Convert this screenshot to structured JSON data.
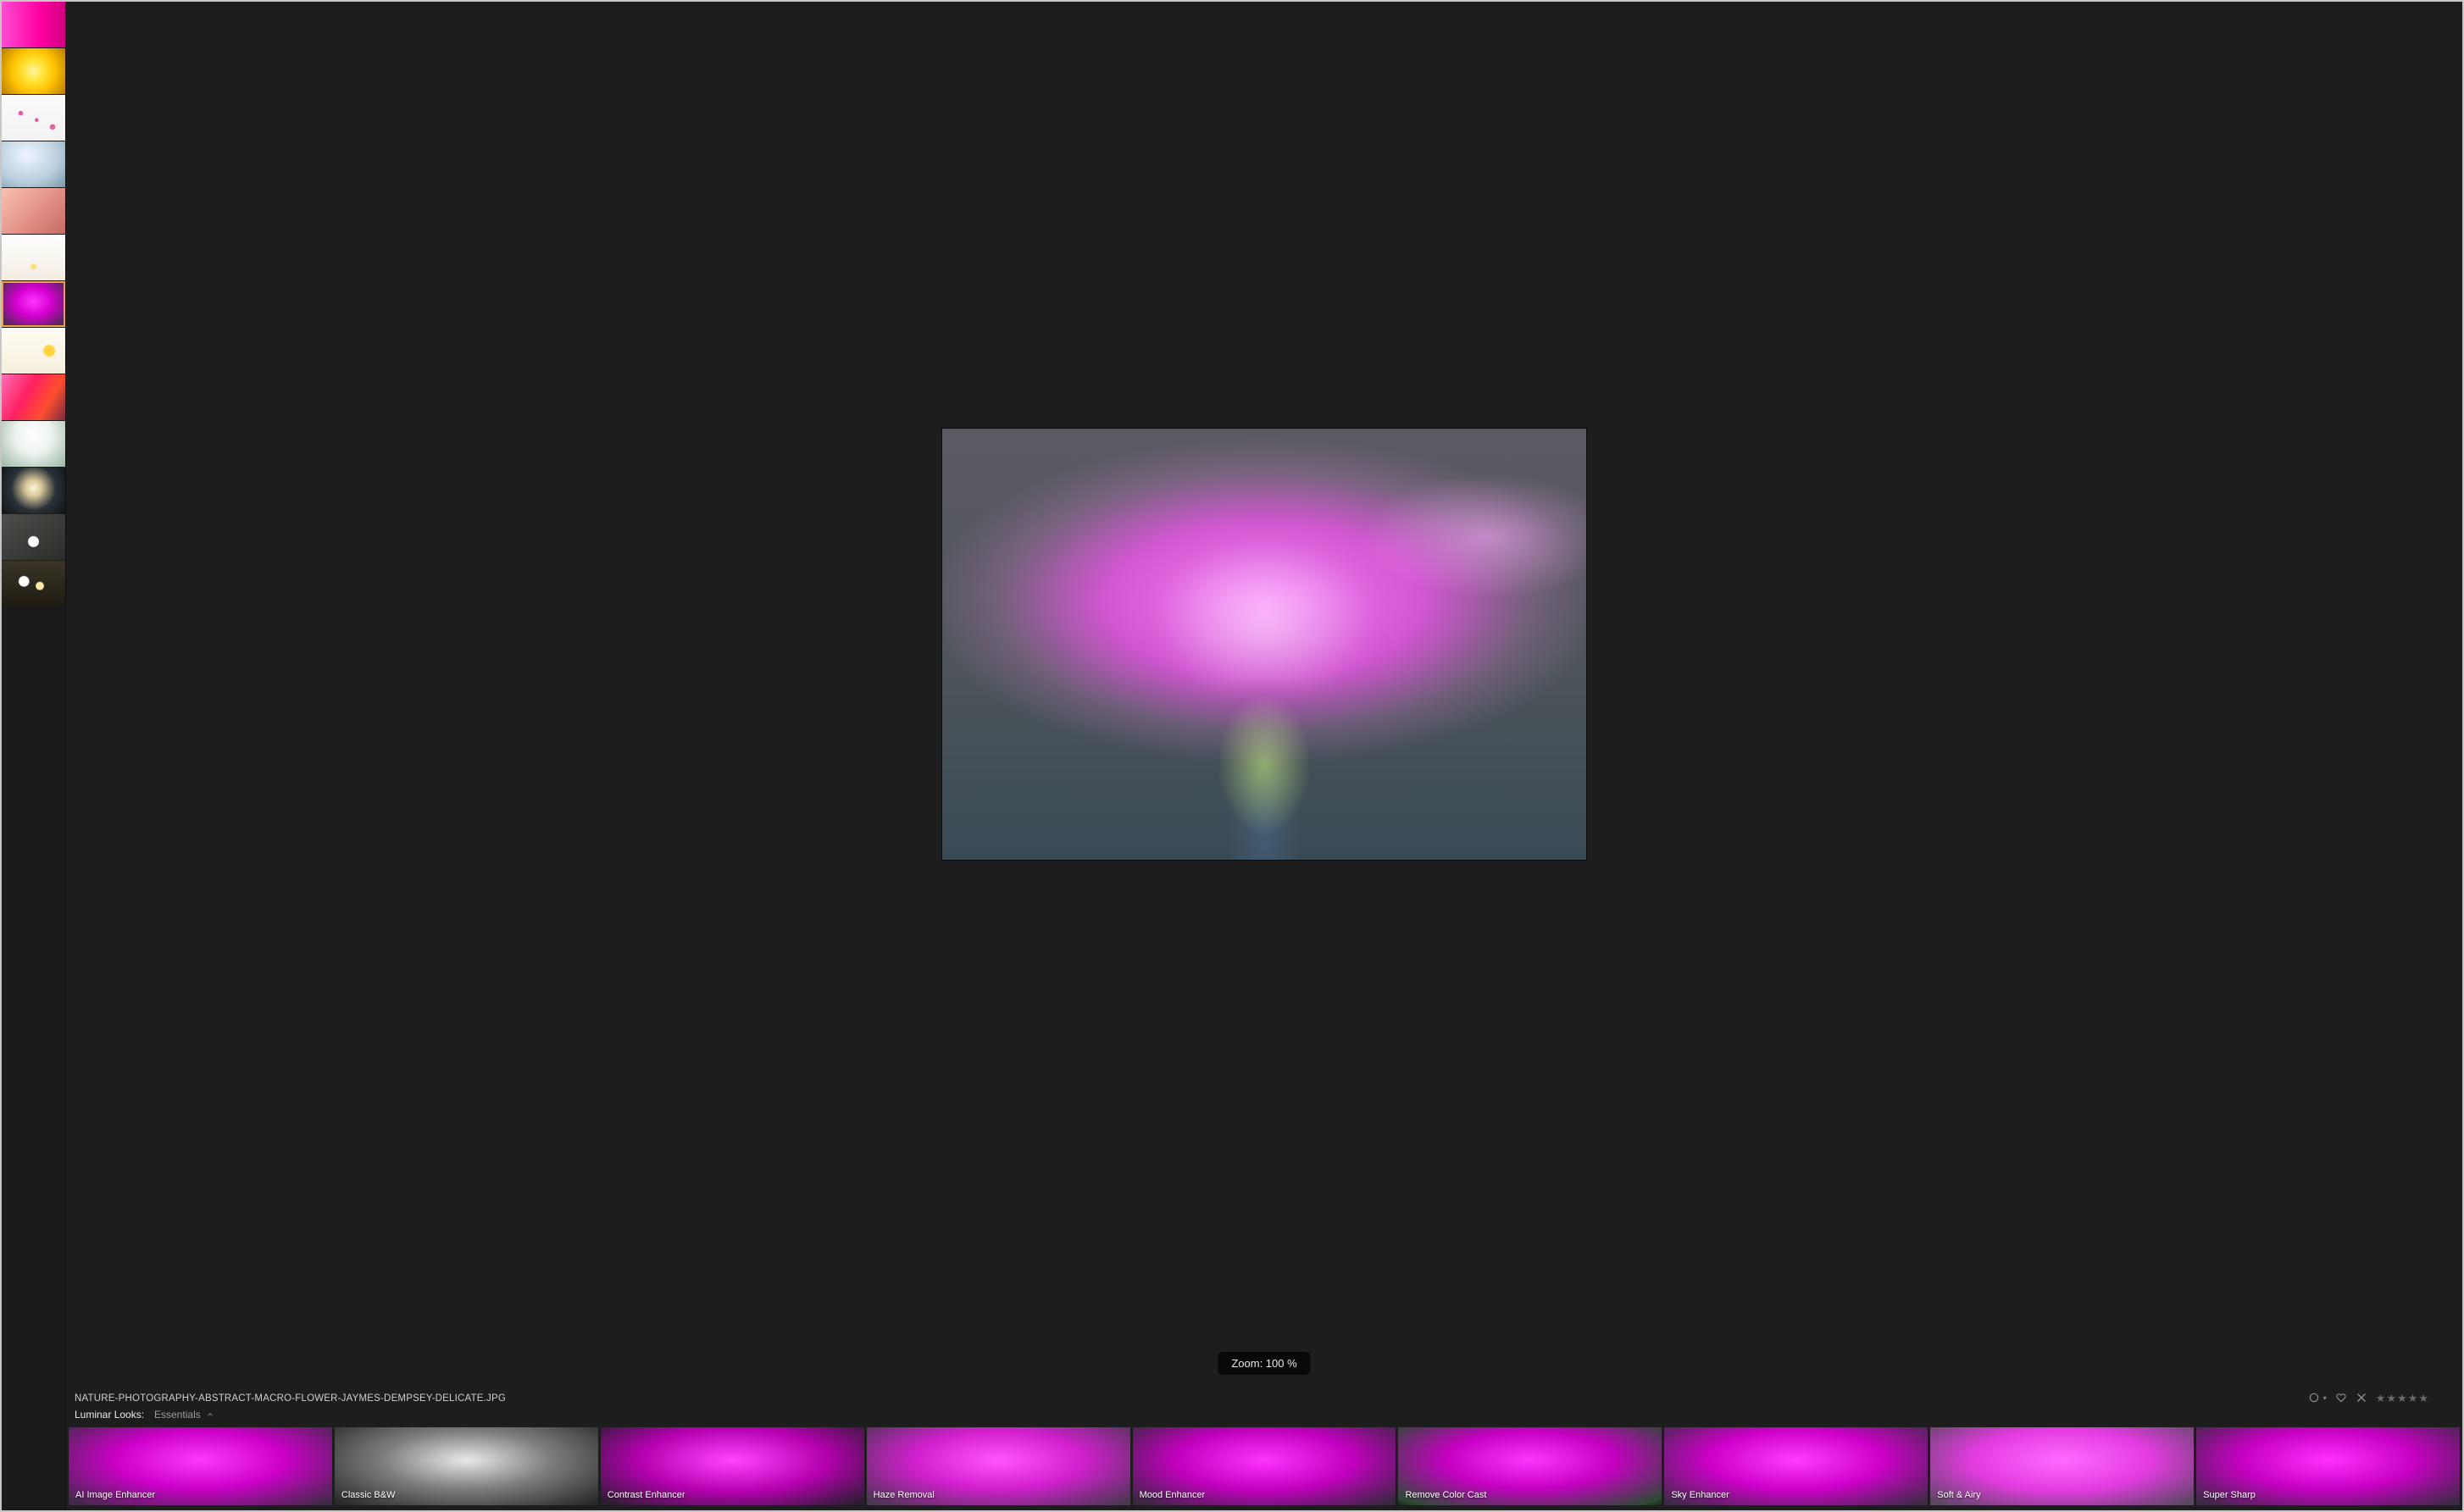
{
  "zoom_badge": "Zoom: 100 %",
  "filename": "NATURE-PHOTOGRAPHY-ABSTRACT-MACRO-FLOWER-JAYMES-DEMPSEY-DELICATE.JPG",
  "looks_header": {
    "label": "Luminar Looks:",
    "category": "Essentials"
  },
  "rating": {
    "stars": 5,
    "filled": 0
  },
  "sidebar_thumbs": [
    {
      "key": "swatch",
      "cls": "thumb-swatch"
    },
    {
      "key": "yellow",
      "cls": "thumb-yellow"
    },
    {
      "key": "branch",
      "cls": "thumb-branch"
    },
    {
      "key": "bluewhite",
      "cls": "thumb-bluewhite"
    },
    {
      "key": "pinkpetal",
      "cls": "thumb-pinkpetal"
    },
    {
      "key": "whitepetal",
      "cls": "thumb-whitepetal"
    },
    {
      "key": "magenta",
      "cls": "thumb-magenta",
      "selected": true
    },
    {
      "key": "yellowdot",
      "cls": "thumb-yellowdot"
    },
    {
      "key": "redorange",
      "cls": "thumb-redorange"
    },
    {
      "key": "tulip",
      "cls": "thumb-tulip"
    },
    {
      "key": "backlit",
      "cls": "thumb-backlit"
    },
    {
      "key": "grayleaf",
      "cls": "thumb-grayleaf"
    },
    {
      "key": "bokeh",
      "cls": "thumb-bokeh"
    }
  ],
  "looks": [
    {
      "label": "AI Image Enhancer",
      "previewCls": "magenta"
    },
    {
      "label": "Classic B&W",
      "previewCls": "bw"
    },
    {
      "label": "Contrast Enhancer",
      "previewCls": "contrast"
    },
    {
      "label": "Haze Removal",
      "previewCls": "haze"
    },
    {
      "label": "Mood Enhancer",
      "previewCls": "mood"
    },
    {
      "label": "Remove Color Cast",
      "previewCls": "cast"
    },
    {
      "label": "Sky Enhancer",
      "previewCls": "sky"
    },
    {
      "label": "Soft & Airy",
      "previewCls": "soft"
    },
    {
      "label": "Super Sharp",
      "previewCls": "sharp"
    }
  ]
}
